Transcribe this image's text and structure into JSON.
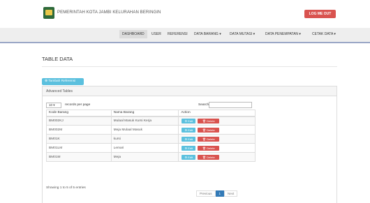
{
  "header": {
    "title": "PEMERINTAH KOTA JAMBI KELURAHAN BERINGIN",
    "logout_label": "LOG ME OUT"
  },
  "nav": {
    "items": [
      {
        "label": "DASHBOARD"
      },
      {
        "label": "USER"
      },
      {
        "label": "REFERENSI"
      },
      {
        "label": "DATA BARANG ▾"
      },
      {
        "label": "DATA MUTASI ▾"
      },
      {
        "label": "DATA PENEMPATAN ▾"
      },
      {
        "label": "CETAK DATA ▾"
      }
    ]
  },
  "page": {
    "title": "TABLE DATA",
    "add_button": "⊕ Tambah Referensi",
    "panel_title": "Advanced Tables"
  },
  "table": {
    "length_value": "10",
    "length_label": "records per page",
    "search_label": "Search:",
    "search_value": "",
    "columns": [
      "Kode Barang",
      "Nama Barang",
      "Action"
    ],
    "rows": [
      {
        "kode": "BM002KJ",
        "nama": "Mulaal Masuk Kursi Kerja"
      },
      {
        "kode": "BM002M",
        "nama": "Meja Mulaal Masuk"
      },
      {
        "kode": "BM01K",
        "nama": "kursi"
      },
      {
        "kode": "BM01LM",
        "nama": "Lemari"
      },
      {
        "kode": "BM01M",
        "nama": "Meja"
      }
    ],
    "edit_label": "⚙ Edit",
    "delete_label": "🗑 Delete",
    "info": "Showing 1 to 5 of 5 entries",
    "pagination": {
      "previous": "Previous",
      "current": "1",
      "next": "Next"
    }
  }
}
